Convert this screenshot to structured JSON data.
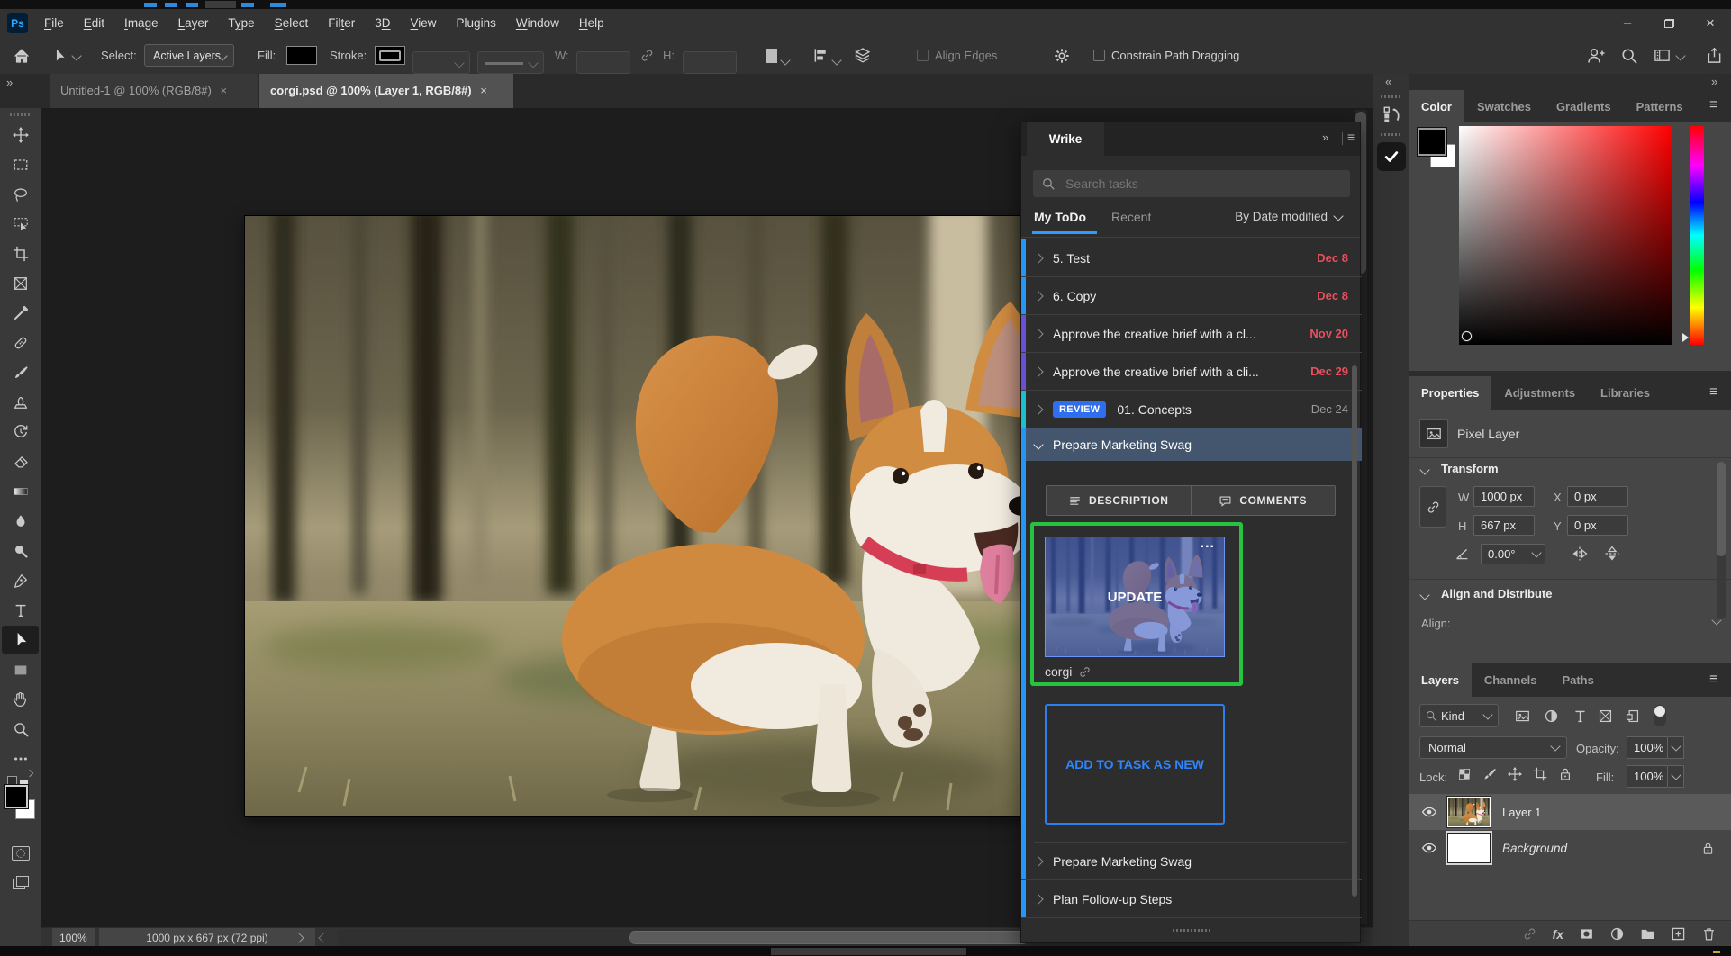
{
  "icons": {
    "ps_logo": "Ps",
    "minimize": "–",
    "close_x": "×",
    "collapse_left": "«",
    "collapse_right": "»",
    "panel_menu": "≡",
    "more": "...",
    "fx": "fx"
  },
  "colors": {
    "accent_blue": "#2E9BFF",
    "selection_green": "#26C33E",
    "date_red": "#EA4F5D",
    "badge_blue": "#2F6FED",
    "ps_logo_blue": "#31A8FF",
    "selected_row": "#44566E"
  },
  "menubar": {
    "items": [
      {
        "label": "File",
        "mnemonic": "F"
      },
      {
        "label": "Edit",
        "mnemonic": "E"
      },
      {
        "label": "Image",
        "mnemonic": "I"
      },
      {
        "label": "Layer",
        "mnemonic": "L"
      },
      {
        "label": "Type",
        "mnemonic": "y"
      },
      {
        "label": "Select",
        "mnemonic": "S"
      },
      {
        "label": "Filter",
        "mnemonic": "t"
      },
      {
        "label": "3D",
        "mnemonic": "D"
      },
      {
        "label": "View",
        "mnemonic": "V"
      },
      {
        "label": "Plugins",
        "mnemonic": ""
      },
      {
        "label": "Window",
        "mnemonic": "W"
      },
      {
        "label": "Help",
        "mnemonic": "H"
      }
    ]
  },
  "options_bar": {
    "select_label": "Select:",
    "select_value": "Active Layers",
    "fill_label": "Fill:",
    "stroke_label": "Stroke:",
    "w_label": "W:",
    "h_label": "H:",
    "align_edges": "Align Edges",
    "constrain": "Constrain Path Dragging"
  },
  "document_tabs": [
    {
      "title": "Untitled-1 @ 100% (RGB/8#)"
    },
    {
      "title": "corgi.psd @ 100% (Layer 1, RGB/8#)"
    }
  ],
  "toolbar": {
    "tools": [
      "move",
      "rectangular-marquee",
      "lasso",
      "object-selection",
      "crop",
      "frame",
      "eyedropper",
      "spot-healing-brush",
      "brush",
      "clone-stamp",
      "history-brush",
      "eraser",
      "gradient",
      "blur",
      "dodge",
      "pen",
      "type",
      "path-selection",
      "rectangle",
      "hand",
      "zoom",
      "edit-toolbar"
    ]
  },
  "wrike": {
    "title": "Wrike",
    "search_placeholder": "Search tasks",
    "tab_my_todo": "My ToDo",
    "tab_recent": "Recent",
    "sort_label": "By Date modified",
    "tasks": [
      {
        "title": "5. Test",
        "date": "Dec 8",
        "strip": "#2496F5",
        "date_color": "#EA4F5D"
      },
      {
        "title": "6. Copy",
        "date": "Dec 8",
        "strip": "#2496F5",
        "date_color": "#EA4F5D"
      },
      {
        "title": "Approve the creative brief with a cl...",
        "date": "Nov 20",
        "strip": "#6A4FD8",
        "date_color": "#EA4F5D"
      },
      {
        "title": "Approve the creative brief with a cli...",
        "date": "Dec 29",
        "strip": "#6A4FD8",
        "date_color": "#EA4F5D"
      },
      {
        "title": "01. Concepts",
        "badge": "REVIEW",
        "date": "Dec 24",
        "strip": "#1BC0CA",
        "date_color": "#9A9A9A"
      }
    ],
    "selected_task": {
      "title": "Prepare Marketing Swag",
      "strip": "#2496F5"
    },
    "detail_tabs": {
      "description": "DESCRIPTION",
      "comments": "COMMENTS"
    },
    "attachment": {
      "name": "corgi",
      "update_label": "UPDATE"
    },
    "add_button_label": "ADD TO TASK AS NEW",
    "bottom_tasks": [
      {
        "title": "Prepare Marketing Swag",
        "strip": "#2496F5"
      },
      {
        "title": "Plan Follow-up Steps",
        "strip": "#2496F5"
      }
    ]
  },
  "color_panel": {
    "tabs": [
      "Color",
      "Swatches",
      "Gradients",
      "Patterns"
    ]
  },
  "properties_panel": {
    "tabs": [
      "Properties",
      "Adjustments",
      "Libraries"
    ],
    "layer_type": "Pixel Layer",
    "transform_label": "Transform",
    "w_label": "W",
    "w_value": "1000 px",
    "x_label": "X",
    "x_value": "0 px",
    "h_label": "H",
    "h_value": "667 px",
    "y_label": "Y",
    "y_value": "0 px",
    "angle_value": "0.00°",
    "align_section_label": "Align and Distribute",
    "align_label": "Align:"
  },
  "layers_panel": {
    "tabs": [
      "Layers",
      "Channels",
      "Paths"
    ],
    "filter_value": "Kind",
    "blend_mode": "Normal",
    "opacity_label": "Opacity:",
    "opacity_value": "100%",
    "lock_label": "Lock:",
    "fill_label": "Fill:",
    "fill_value": "100%",
    "layers": [
      {
        "name": "Layer 1"
      },
      {
        "name": "Background"
      }
    ]
  },
  "status_bar": {
    "zoom": "100%",
    "doc_info": "1000 px x 667 px (72 ppi)"
  }
}
